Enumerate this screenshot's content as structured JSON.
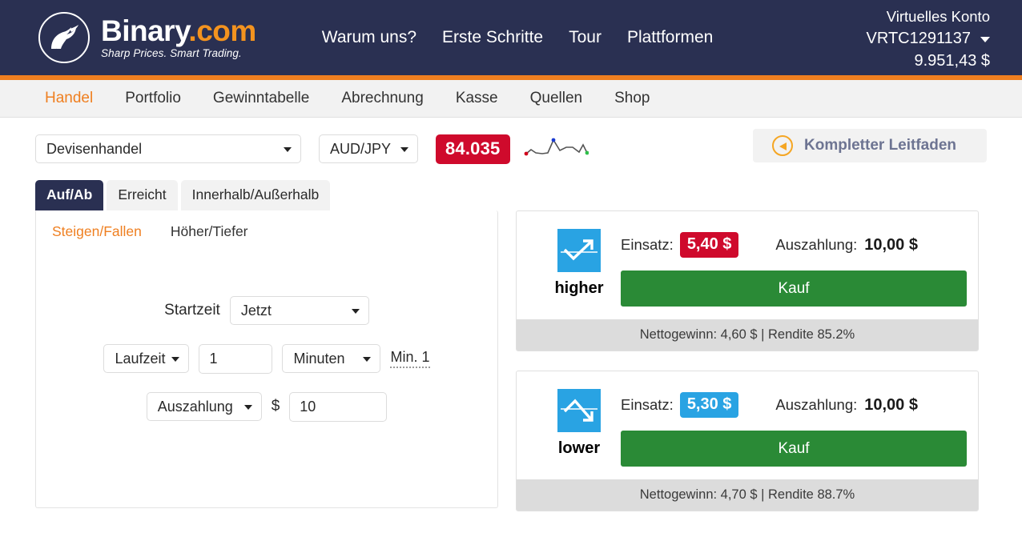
{
  "header": {
    "logo": {
      "word_primary": "Binary",
      "word_secondary": ".com",
      "tagline": "Sharp Prices. Smart Trading."
    },
    "nav": [
      {
        "label": "Warum uns?"
      },
      {
        "label": "Erste Schritte"
      },
      {
        "label": "Tour"
      },
      {
        "label": "Plattformen"
      }
    ],
    "account": {
      "type_label": "Virtuelles Konto",
      "account_id": "VRTC1291137",
      "balance": "9.951,43 $"
    }
  },
  "subnav": {
    "items": [
      {
        "label": "Handel",
        "active": true
      },
      {
        "label": "Portfolio",
        "active": false
      },
      {
        "label": "Gewinntabelle",
        "active": false
      },
      {
        "label": "Abrechnung",
        "active": false
      },
      {
        "label": "Kasse",
        "active": false
      },
      {
        "label": "Quellen",
        "active": false
      },
      {
        "label": "Shop",
        "active": false
      }
    ]
  },
  "market": {
    "market_select": "Devisenhandel",
    "symbol_select": "AUD/JPY",
    "spot_price": "84.035",
    "guide_label": "Kompletter Leitfaden"
  },
  "contract_tabs": [
    {
      "label": "Auf/Ab",
      "active": true
    },
    {
      "label": "Erreicht",
      "active": false
    },
    {
      "label": "Innerhalb/Außerhalb",
      "active": false
    }
  ],
  "contract_subtabs": [
    {
      "label": "Steigen/Fallen",
      "active": true
    },
    {
      "label": "Höher/Tiefer",
      "active": false
    }
  ],
  "form": {
    "start_time_label": "Startzeit",
    "start_time_value": "Jetzt",
    "duration_mode": "Laufzeit",
    "duration_value": "1",
    "duration_unit": "Minuten",
    "duration_min_note": "Min. 1",
    "payout_mode": "Auszahlung",
    "currency_symbol": "$",
    "amount_value": "10"
  },
  "trades": [
    {
      "direction": "higher",
      "direction_icon": "arrow-up-icon",
      "stake_label": "Einsatz:",
      "stake_value": "5,40 $",
      "stake_color": "#cf0a2c",
      "payout_label": "Auszahlung:",
      "payout_value": "10,00 $",
      "buy_label": "Kauf",
      "footer": "Nettogewinn: 4,60 $ | Rendite 85.2%"
    },
    {
      "direction": "lower",
      "direction_icon": "arrow-down-icon",
      "stake_label": "Einsatz:",
      "stake_value": "5,30 $",
      "stake_color": "#29a3e3",
      "payout_label": "Auszahlung:",
      "payout_value": "10,00 $",
      "buy_label": "Kauf",
      "footer": "Nettogewinn: 4,70 $ | Rendite 88.7%"
    }
  ],
  "colors": {
    "header_bg": "#2a3052",
    "accent_orange": "#ef7f20",
    "buy_green": "#2a8a36",
    "price_red": "#cf0a2c",
    "icon_blue": "#29a3e3"
  }
}
